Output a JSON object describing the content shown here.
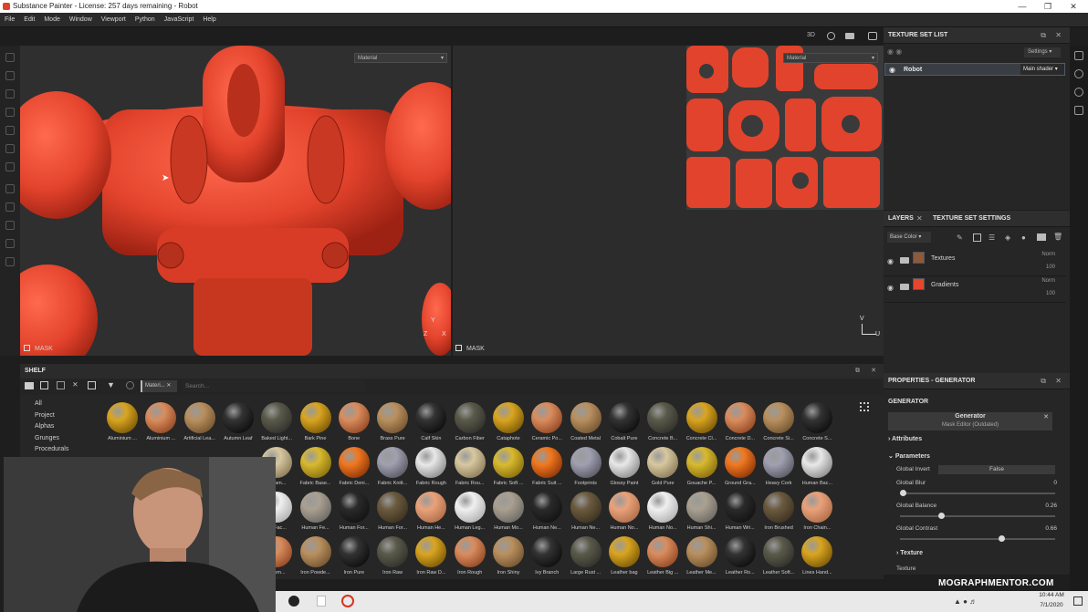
{
  "window": {
    "title": "Substance Painter - License: 257 days remaining - Robot"
  },
  "menu": [
    "File",
    "Edit",
    "Mode",
    "Window",
    "Viewport",
    "Python",
    "JavaScript",
    "Help"
  ],
  "viewport3d": {
    "dropdown": "Material",
    "mask_label": "MASK",
    "axis_y": "Y",
    "axis_z": "Z",
    "axis_x": "X"
  },
  "viewport2d": {
    "dropdown": "Material",
    "mask_label": "MASK",
    "axis_v": "V",
    "axis_u": "U"
  },
  "texture_set_list": {
    "title": "TEXTURE SET LIST",
    "settings_label": "Settings",
    "set_name": "Robot",
    "shader": "Main shader"
  },
  "layers_panel": {
    "tab_layers": "LAYERS",
    "tab_tss": "TEXTURE SET SETTINGS",
    "channel": "Base Color",
    "layers": [
      {
        "name": "Textures",
        "blend": "Norm",
        "opacity": "100"
      },
      {
        "name": "Gradients",
        "blend": "Norm",
        "opacity": "100"
      }
    ]
  },
  "properties": {
    "title": "PROPERTIES - GENERATOR",
    "section": "GENERATOR",
    "generator_name": "Generator",
    "generator_sub": "Mask Editor (Outdated)",
    "attributes": "Attributes",
    "parameters": "Parameters",
    "global_invert_label": "Global Invert",
    "global_invert_value": "False",
    "global_blur_label": "Global Blur",
    "global_blur_value": "0",
    "global_blur_level": 0.0,
    "global_balance_label": "Global Balance",
    "global_balance_value": "0.26",
    "global_balance_level": 0.26,
    "global_contrast_label": "Global Contrast",
    "global_contrast_value": "0.66",
    "global_contrast_level": 0.66,
    "texture_section": "Texture",
    "texture_label": "Texture"
  },
  "shelf": {
    "title": "SHELF",
    "filter_tag": "Materi...",
    "search_placeholder": "Search...",
    "categories": [
      "All",
      "Project",
      "Alphas",
      "Grunges",
      "Procedurals"
    ],
    "rows": [
      [
        "Aluminium ...",
        "Aluminium ...",
        "Artificial Lea...",
        "Autumn Leaf",
        "Baked Light...",
        "Bark Pine",
        "Bone",
        "Brass Pure",
        "Calf Skin",
        "Carbon Fiber",
        "Cataphote",
        "Ceramic Po...",
        "Coated Metal",
        "Cobalt Pure",
        "Concrete B...",
        "Concrete Cl...",
        "Concrete D...",
        "Concrete Si...",
        "Concrete S..."
      ],
      [
        "",
        "",
        "",
        "",
        "c Bam...",
        "Fabric Base...",
        "Fabric Deni...",
        "Fabric Knitt...",
        "Fabric Rough",
        "Fabric Rou...",
        "Fabric Soft ...",
        "Fabric Suit ...",
        "Footprints",
        "Glossy Paint",
        "Gold Pure",
        "Gouache P...",
        "Ground Gra...",
        "Heavy Cork",
        "Human Bac..."
      ],
      [
        "",
        "",
        "",
        "",
        "an Fac...",
        "Human Fe...",
        "Human For...",
        "Human For...",
        "Human He...",
        "Human Leg...",
        "Human Mo...",
        "Human Ne...",
        "Human Ne...",
        "Human No...",
        "Human No...",
        "Human Shi...",
        "Human Wri...",
        "Iron Brushed",
        "Iron Chain..."
      ],
      [
        "",
        "",
        "",
        "",
        "ramm...",
        "Iron Powde...",
        "Iron Pure",
        "Iron Raw",
        "Iron Raw D...",
        "Iron Rough",
        "Iron Shiny",
        "Ivy Branch",
        "Large Rust ...",
        "Leather bag",
        "Leather Big ...",
        "Leather Me...",
        "Leather Ro...",
        "Leather Soft...",
        "Lines Hand..."
      ]
    ]
  },
  "watermark": "MOGRAPHMENTOR.COM",
  "taskbar": {
    "time": "10:44 AM",
    "date": "7/1/2020"
  },
  "colors": {
    "robot_red": "#e8452f",
    "accent_blue": "#4c5c70"
  }
}
